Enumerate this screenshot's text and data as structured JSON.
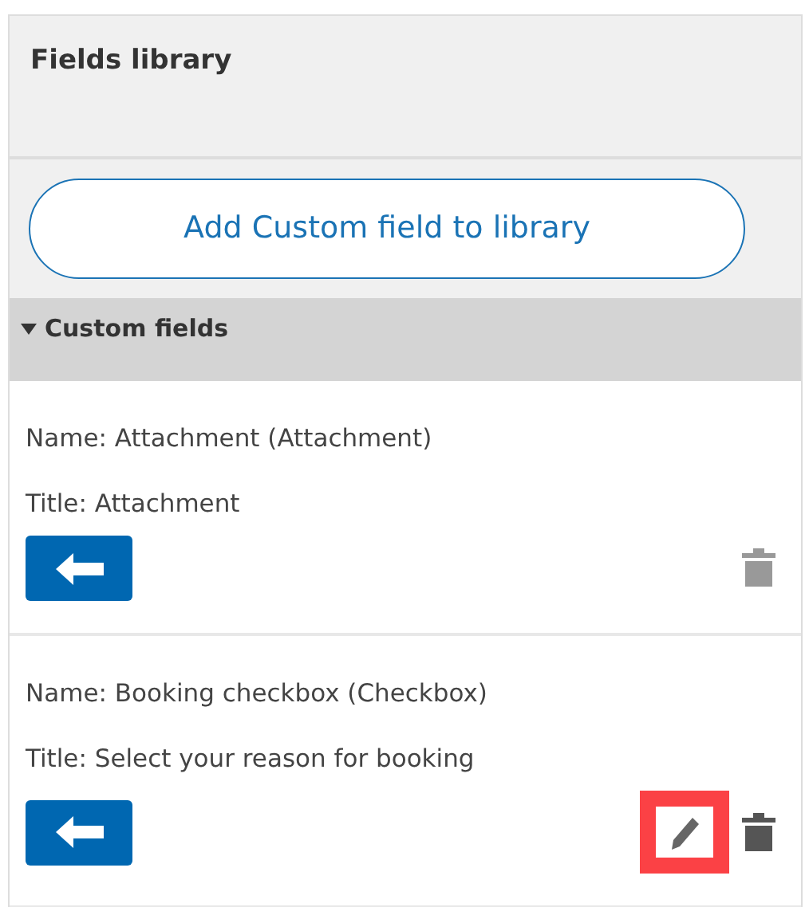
{
  "panel": {
    "title": "Fields library"
  },
  "add_button": {
    "label": "Add Custom field to library"
  },
  "section": {
    "label": "Custom fields",
    "expanded": true
  },
  "fields": [
    {
      "name": "Name: Attachment (Attachment)",
      "title": "Title: Attachment",
      "editable": false,
      "delete_disabled": true
    },
    {
      "name": "Name: Booking checkbox (Checkbox)",
      "title": "Title: Select your reason for booking",
      "editable": true,
      "delete_disabled": false,
      "edit_highlighted": true
    }
  ]
}
